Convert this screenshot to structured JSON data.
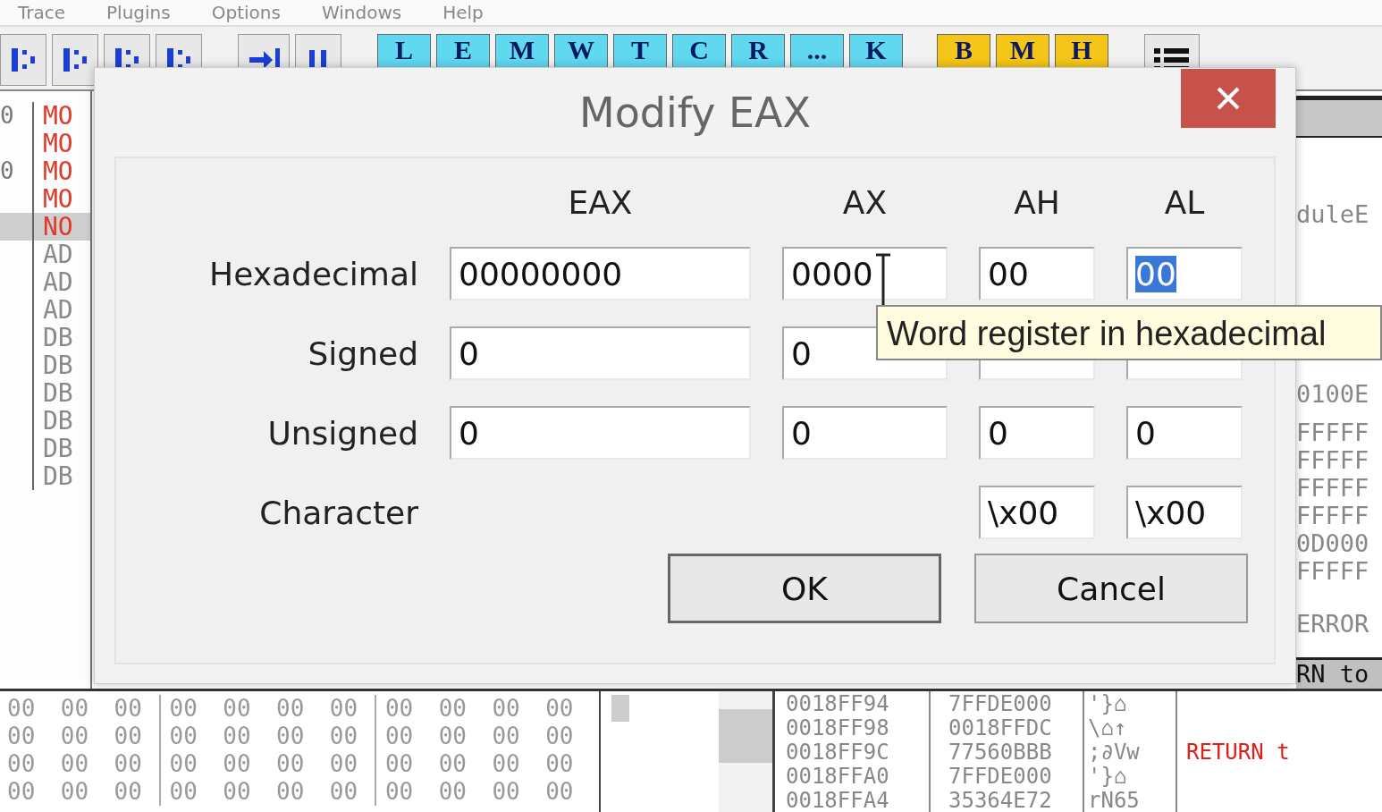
{
  "menu": [
    "Trace",
    "Plugins",
    "Options",
    "Windows",
    "Help"
  ],
  "toolbar": {
    "letters": [
      {
        "label": "L",
        "color": "#5fd8f0"
      },
      {
        "label": "E",
        "color": "#5fd8f0"
      },
      {
        "label": "M",
        "color": "#5fd8f0"
      },
      {
        "label": "W",
        "color": "#5fd8f0"
      },
      {
        "label": "T",
        "color": "#5fd8f0"
      },
      {
        "label": "C",
        "color": "#5fd8f0"
      },
      {
        "label": "R",
        "color": "#5fd8f0"
      },
      {
        "label": "...",
        "color": "#5fd8f0"
      },
      {
        "label": "K",
        "color": "#5fd8f0"
      },
      {
        "label": "B",
        "color": "#f5c518"
      },
      {
        "label": "M",
        "color": "#f5c518"
      },
      {
        "label": "H",
        "color": "#f5c518"
      }
    ]
  },
  "disassembly": {
    "rows": [
      {
        "address": "0",
        "instruction": "MO",
        "color": "#e03a2a",
        "selected": false
      },
      {
        "instruction": "MO",
        "color": "#e03a2a",
        "selected": false
      },
      {
        "address": "0",
        "instruction": "MO",
        "color": "#e03a2a",
        "selected": false
      },
      {
        "instruction": "MO",
        "color": "#e03a2a",
        "selected": false
      },
      {
        "instruction": "NO",
        "color": "#e03a2a",
        "selected": true
      },
      {
        "instruction": "AD",
        "color": "#8a8a8a",
        "selected": false
      },
      {
        "instruction": "AD",
        "color": "#8a8a8a",
        "selected": false
      },
      {
        "instruction": "AD",
        "color": "#8a8a8a",
        "selected": false
      },
      {
        "instruction": "DB",
        "color": "#8a8a8a",
        "selected": false
      },
      {
        "instruction": "DB",
        "color": "#8a8a8a",
        "selected": false
      },
      {
        "instruction": "DB",
        "color": "#8a8a8a",
        "selected": false
      },
      {
        "instruction": "DB",
        "color": "#8a8a8a",
        "selected": false
      },
      {
        "instruction": "DB",
        "color": "#8a8a8a",
        "selected": false
      },
      {
        "instruction": "DB",
        "color": "#8a8a8a",
        "selected": false
      }
    ]
  },
  "registers": {
    "lines": [
      "duleE",
      "0100E",
      "FFFFF",
      "FFFFF",
      "FFFFF",
      "FFFFF",
      "0D000",
      "FFFFF",
      "ERROR"
    ],
    "footer": "RN to"
  },
  "hex_dump": {
    "rows": [
      [
        "00",
        "00",
        "00",
        "00",
        "00",
        "00",
        "00",
        "00",
        "00",
        "00",
        "00"
      ],
      [
        "00",
        "00",
        "00",
        "00",
        "00",
        "00",
        "00",
        "00",
        "00",
        "00",
        "00"
      ],
      [
        "00",
        "00",
        "00",
        "00",
        "00",
        "00",
        "00",
        "00",
        "00",
        "00",
        "00"
      ],
      [
        "00",
        "00",
        "00",
        "00",
        "00",
        "00",
        "00",
        "00",
        "00",
        "00",
        "00"
      ]
    ]
  },
  "stack": {
    "rows": [
      {
        "address": "0018FF94",
        "value": "7FFDE000",
        "ascii": "'}⌂"
      },
      {
        "address": "0018FF98",
        "value": "0018FFDC",
        "ascii": "\\⌂↑"
      },
      {
        "address": "0018FF9C",
        "value": "77560BBB",
        "ascii": ";∂Vw",
        "comment": "RETURN t"
      },
      {
        "address": "0018FFA0",
        "value": "7FFDE000",
        "ascii": "'}⌂"
      },
      {
        "address": "0018FFA4",
        "value": "35364E72",
        "ascii": "rN65"
      }
    ]
  },
  "dialog": {
    "title": "Modify EAX",
    "columns": [
      "EAX",
      "AX",
      "AH",
      "AL"
    ],
    "rows": [
      {
        "label": "Hexadecimal",
        "eax": {
          "value": "00000000",
          "text_selected": false
        },
        "ax": {
          "value": "0000",
          "text_selected": false
        },
        "ah": {
          "value": "00",
          "text_selected": false
        },
        "al": {
          "value": "00",
          "text_selected": true
        }
      },
      {
        "label": "Signed",
        "eax": {
          "value": "0",
          "text_selected": false
        },
        "ax": {
          "value": "0",
          "text_selected": false
        },
        "ah": {},
        "al": {}
      },
      {
        "label": "Unsigned",
        "eax": {
          "value": "0",
          "text_selected": false
        },
        "ax": {
          "value": "0",
          "text_selected": false
        },
        "ah": {
          "value": "0",
          "text_selected": false
        },
        "al": {
          "value": "0",
          "text_selected": false
        }
      },
      {
        "label": "Character",
        "ah": {
          "value": "\\x00",
          "text_selected": false
        },
        "al": {
          "value": "\\x00",
          "text_selected": false
        }
      }
    ],
    "buttons": [
      "OK",
      "Cancel"
    ],
    "tooltip": "Word register in hexadecimal"
  }
}
